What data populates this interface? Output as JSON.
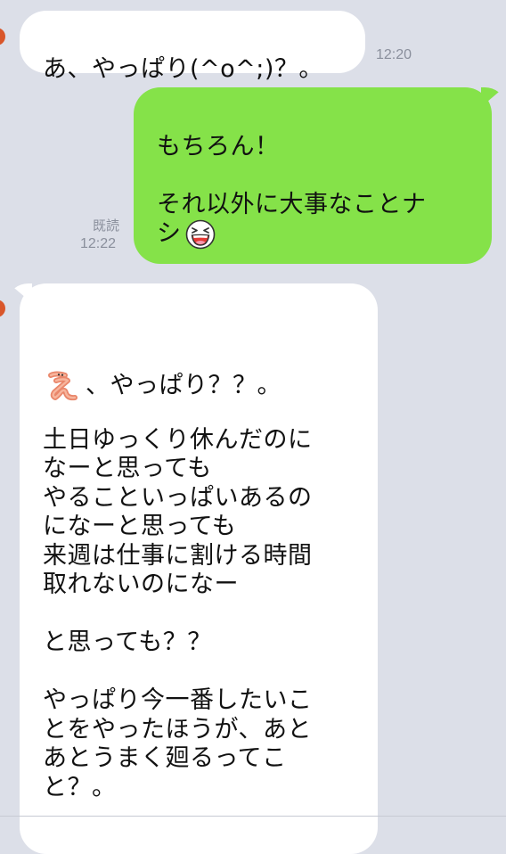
{
  "messages": [
    {
      "id": "m1",
      "direction": "incoming",
      "text": "あ、やっぱり(^o^;)？。",
      "time": "12:20"
    },
    {
      "id": "m2",
      "direction": "outgoing",
      "text": "もちろん！\n\nそれ以外に大事なことナ\nシ",
      "emoji": "laughing-face-icon",
      "read_label": "既読",
      "time": "12:22"
    },
    {
      "id": "m3",
      "direction": "incoming",
      "emoji": "character-e-icon",
      "first_line": "、やっぱり？？。",
      "text": "\n土日ゆっくり休んだのに\nなーと思っても\nやることいっぱいあるの\nになーと思っても\n来週は仕事に割ける時間\n取れないのになー\n\nと思っても？？\n\nやっぱり今一番したいこ\nとをやったほうが、あと\nあとうまく廻るってこ\nと？。"
    }
  ],
  "colors": {
    "background": "#dcdfe8",
    "incoming_bubble": "#ffffff",
    "outgoing_bubble": "#85e249",
    "meta_text": "#8a8f9c",
    "avatar_accent": "#d9562a"
  }
}
